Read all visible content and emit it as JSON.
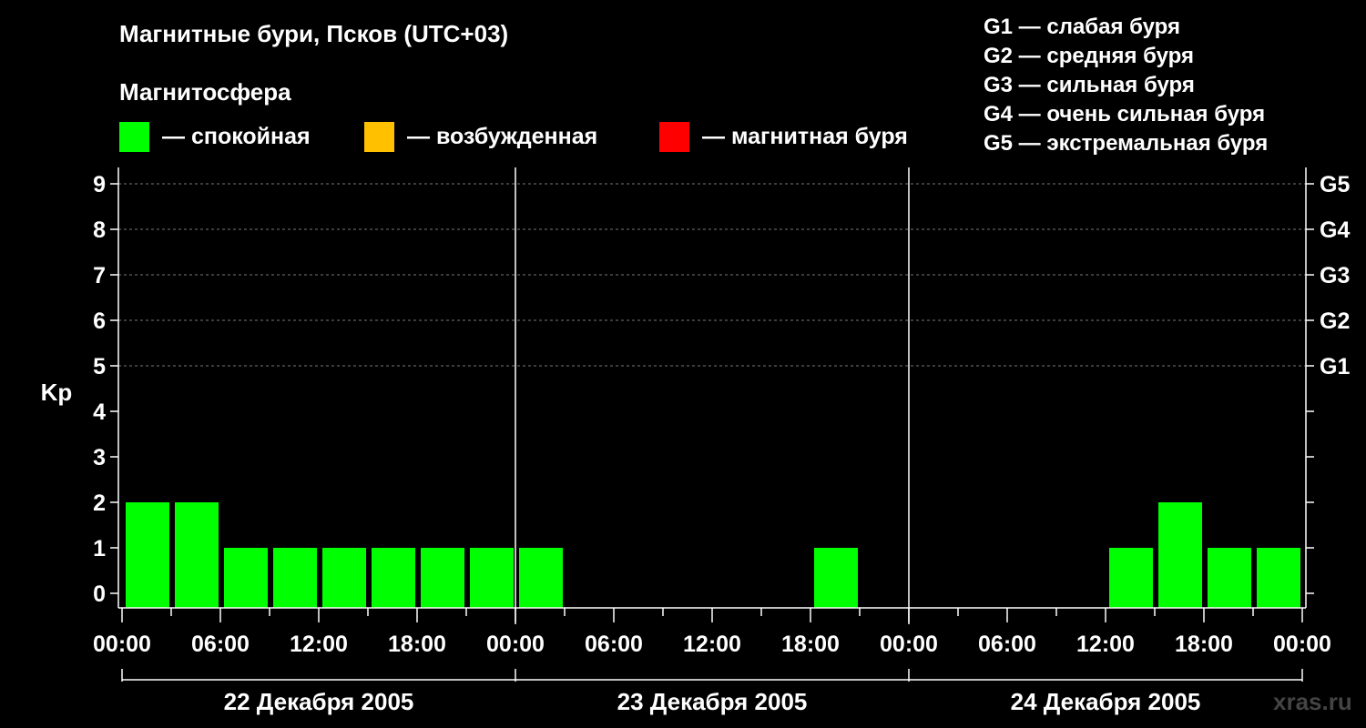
{
  "header": {
    "title": "Магнитные бури, Псков (UTC+03)",
    "subtitle": "Магнитосфера"
  },
  "legend": [
    {
      "label": "— спокойная",
      "color": "#00ff00"
    },
    {
      "label": "— возбужденная",
      "color": "#ffc000"
    },
    {
      "label": "— магнитная буря",
      "color": "#ff0000"
    }
  ],
  "g_legend": [
    "G1 — слабая буря",
    "G2 — средняя буря",
    "G3 — сильная буря",
    "G4 — очень сильная буря",
    "G5 — экстремальная буря"
  ],
  "watermark": "xras.ru",
  "chart_data": {
    "type": "bar",
    "ylabel": "Kp",
    "ylim": [
      0,
      9
    ],
    "yticks": [
      "0",
      "1",
      "2",
      "3",
      "4",
      "5",
      "6",
      "7",
      "8",
      "9"
    ],
    "g_scale": [
      {
        "label": "G1",
        "kp": 5
      },
      {
        "label": "G2",
        "kp": 6
      },
      {
        "label": "G3",
        "kp": 7
      },
      {
        "label": "G4",
        "kp": 8
      },
      {
        "label": "G5",
        "kp": 9
      }
    ],
    "xticks": [
      "00:00",
      "06:00",
      "12:00",
      "18:00",
      "00:00",
      "06:00",
      "12:00",
      "18:00",
      "00:00",
      "06:00",
      "12:00",
      "18:00",
      "00:00"
    ],
    "days": [
      "22 Декабря 2005",
      "23 Декабря 2005",
      "24 Декабря 2005"
    ],
    "intervals_per_day": 8,
    "values": [
      2,
      2,
      1,
      1,
      1,
      1,
      1,
      1,
      1,
      0,
      0,
      0,
      0,
      0,
      1,
      0,
      0,
      0,
      0,
      0,
      1,
      2,
      1,
      1
    ],
    "colors": {
      "quiet": "#00ff00",
      "active": "#ffc000",
      "storm": "#ff0000"
    },
    "grid": "dashed at Kp 5–9"
  }
}
